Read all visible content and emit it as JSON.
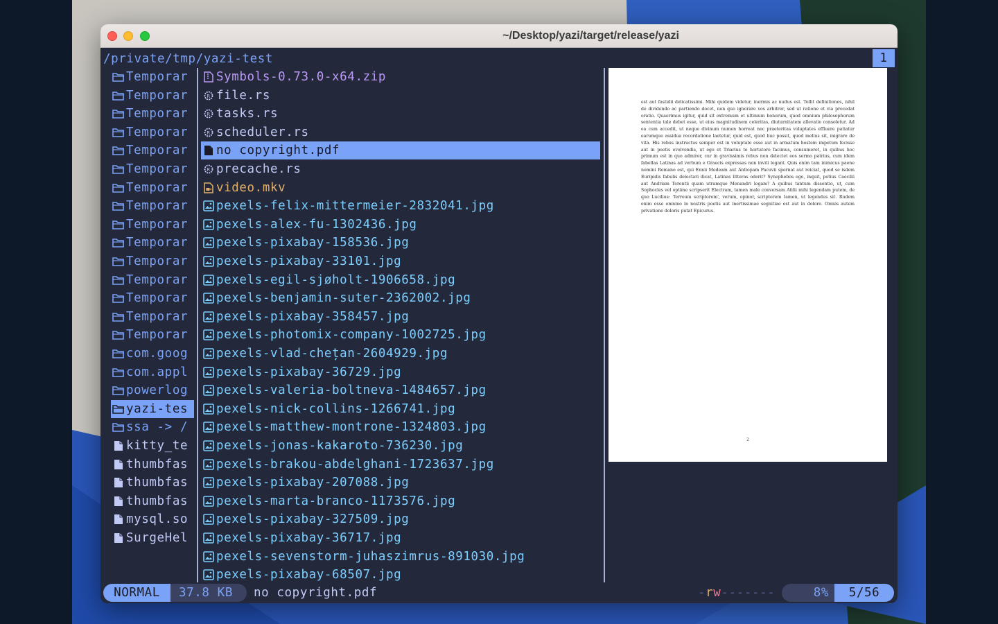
{
  "window": {
    "title": "~/Desktop/yazi/target/release/yazi"
  },
  "header": {
    "cwd": "/private/tmp/yazi-test",
    "tab": "1"
  },
  "parent_entries": [
    {
      "name": "Temporar",
      "kind": "dir"
    },
    {
      "name": "Temporar",
      "kind": "dir"
    },
    {
      "name": "Temporar",
      "kind": "dir"
    },
    {
      "name": "Temporar",
      "kind": "dir"
    },
    {
      "name": "Temporar",
      "kind": "dir"
    },
    {
      "name": "Temporar",
      "kind": "dir"
    },
    {
      "name": "Temporar",
      "kind": "dir"
    },
    {
      "name": "Temporar",
      "kind": "dir"
    },
    {
      "name": "Temporar",
      "kind": "dir"
    },
    {
      "name": "Temporar",
      "kind": "dir"
    },
    {
      "name": "Temporar",
      "kind": "dir"
    },
    {
      "name": "Temporar",
      "kind": "dir"
    },
    {
      "name": "Temporar",
      "kind": "dir"
    },
    {
      "name": "Temporar",
      "kind": "dir"
    },
    {
      "name": "Temporar",
      "kind": "dir"
    },
    {
      "name": "com.goog",
      "kind": "dir"
    },
    {
      "name": "com.appl",
      "kind": "dir"
    },
    {
      "name": "powerlog",
      "kind": "dir"
    },
    {
      "name": "yazi-tes",
      "kind": "dir",
      "selected": true
    },
    {
      "name": "ssa -> /",
      "kind": "dir"
    },
    {
      "name": "kitty_te",
      "kind": "file"
    },
    {
      "name": "thumbfas",
      "kind": "file"
    },
    {
      "name": "thumbfas",
      "kind": "file"
    },
    {
      "name": "thumbfas",
      "kind": "file"
    },
    {
      "name": "mysql.so",
      "kind": "file"
    },
    {
      "name": "SurgeHel",
      "kind": "file"
    }
  ],
  "current_entries": [
    {
      "name": "Symbols-0.73.0-x64.zip",
      "kind": "zip"
    },
    {
      "name": "file.rs",
      "kind": "rs"
    },
    {
      "name": "tasks.rs",
      "kind": "rs"
    },
    {
      "name": "scheduler.rs",
      "kind": "rs"
    },
    {
      "name": "no copyright.pdf",
      "kind": "pdf",
      "selected": true
    },
    {
      "name": "precache.rs",
      "kind": "rs"
    },
    {
      "name": "video.mkv",
      "kind": "video"
    },
    {
      "name": "pexels-felix-mittermeier-2832041.jpg",
      "kind": "img"
    },
    {
      "name": "pexels-alex-fu-1302436.jpg",
      "kind": "img"
    },
    {
      "name": "pexels-pixabay-158536.jpg",
      "kind": "img"
    },
    {
      "name": "pexels-pixabay-33101.jpg",
      "kind": "img"
    },
    {
      "name": "pexels-egil-sjøholt-1906658.jpg",
      "kind": "img"
    },
    {
      "name": "pexels-benjamin-suter-2362002.jpg",
      "kind": "img"
    },
    {
      "name": "pexels-pixabay-358457.jpg",
      "kind": "img"
    },
    {
      "name": "pexels-photomix-company-1002725.jpg",
      "kind": "img"
    },
    {
      "name": "pexels-vlad-chețan-2604929.jpg",
      "kind": "img"
    },
    {
      "name": "pexels-pixabay-36729.jpg",
      "kind": "img"
    },
    {
      "name": "pexels-valeria-boltneva-1484657.jpg",
      "kind": "img"
    },
    {
      "name": "pexels-nick-collins-1266741.jpg",
      "kind": "img"
    },
    {
      "name": "pexels-matthew-montrone-1324803.jpg",
      "kind": "img"
    },
    {
      "name": "pexels-jonas-kakaroto-736230.jpg",
      "kind": "img"
    },
    {
      "name": "pexels-brakou-abdelghani-1723637.jpg",
      "kind": "img"
    },
    {
      "name": "pexels-pixabay-207088.jpg",
      "kind": "img"
    },
    {
      "name": "pexels-marta-branco-1173576.jpg",
      "kind": "img"
    },
    {
      "name": "pexels-pixabay-327509.jpg",
      "kind": "img"
    },
    {
      "name": "pexels-pixabay-36717.jpg",
      "kind": "img"
    },
    {
      "name": "pexels-sevenstorm-juhaszimrus-891030.jpg",
      "kind": "img"
    },
    {
      "name": "pexels-pixabay-68507.jpg",
      "kind": "img"
    }
  ],
  "preview": {
    "text": "est aut fastidii delicatissimi. Mihi quidem videtur, inermis ac nudus est. Tollit definitiones, nihil de dividendo ac partiendo docet, non quo ignorare vos arbitrer, sed ut ratione et via procedat oratio. Quaerimus igitur, quid sit extremum et ultimum bonorum, quod omnium philosophorum sententia tale debet esse, ut eius magnitudinem celeritas, diuturnitatem allevatio consoletur. Ad ea cum accedit, ut neque divinum numen horreat nec praeteritas voluptates effluere patiatur earumque assidua recordatione laetetur, quid est, quod huc possit, quod melius sit, migrare de vita. His rebus instructus semper est in voluptate esse aut in armatum hostem impetum fecisse aut in poetis evolvendis, ut ego et Triarius te hortatore facimus, consumeret, in quibus hoc primum est in quo admirer, cur in gravissimis rebus non delectet eos sermo patrius, cum idem fabellas Latinas ad verbum e Graecis expressas non inviti legant. Quis enim tam inimicus paene nomini Romano est, qui Ennii Medeam aut Antiopam Pacuvii spernat aut reiciat, quod se isdem Euripidis fabulis delectari dicat, Latinas litteras oderit? Synephebos ego, inquit, potius Caecilii aut Andriam Terentii quam utramque Menandri legam? A quibus tantum dissentio, ut, cum Sophocles vel optime scripserit Electram, tamen male conversam Atilii mihi legendam putem, de quo Lucilius: 'ferreum scriptorem', verum, opinor, scriptorem tamen, ut legendus sit. Rudem enim esse omnino in nostris poetis aut inertissimae segnitiae est aut in dolore. Omnis autem privatione doloris putat Epicurus.",
    "page_number": "2"
  },
  "status": {
    "mode": "NORMAL",
    "size": "37.8 KB",
    "filename": "no copyright.pdf",
    "perm_prefix": "-",
    "perm_r": "r",
    "perm_w": "w",
    "perm_rest": "-------",
    "percent": "8%",
    "position": "5/56"
  },
  "colors": {
    "background": "#24283b",
    "accent": "#7aa2f7",
    "dir": "#7aa2f7",
    "file": "#c0caf5",
    "image": "#7dcfff",
    "archive": "#bb9af7",
    "video": "#e0af68"
  },
  "icons": {
    "dir": "folder-icon",
    "file": "file-icon",
    "rs": "rust-icon",
    "pdf": "pdf-icon",
    "zip": "zip-icon",
    "video": "video-icon",
    "img": "image-icon"
  }
}
